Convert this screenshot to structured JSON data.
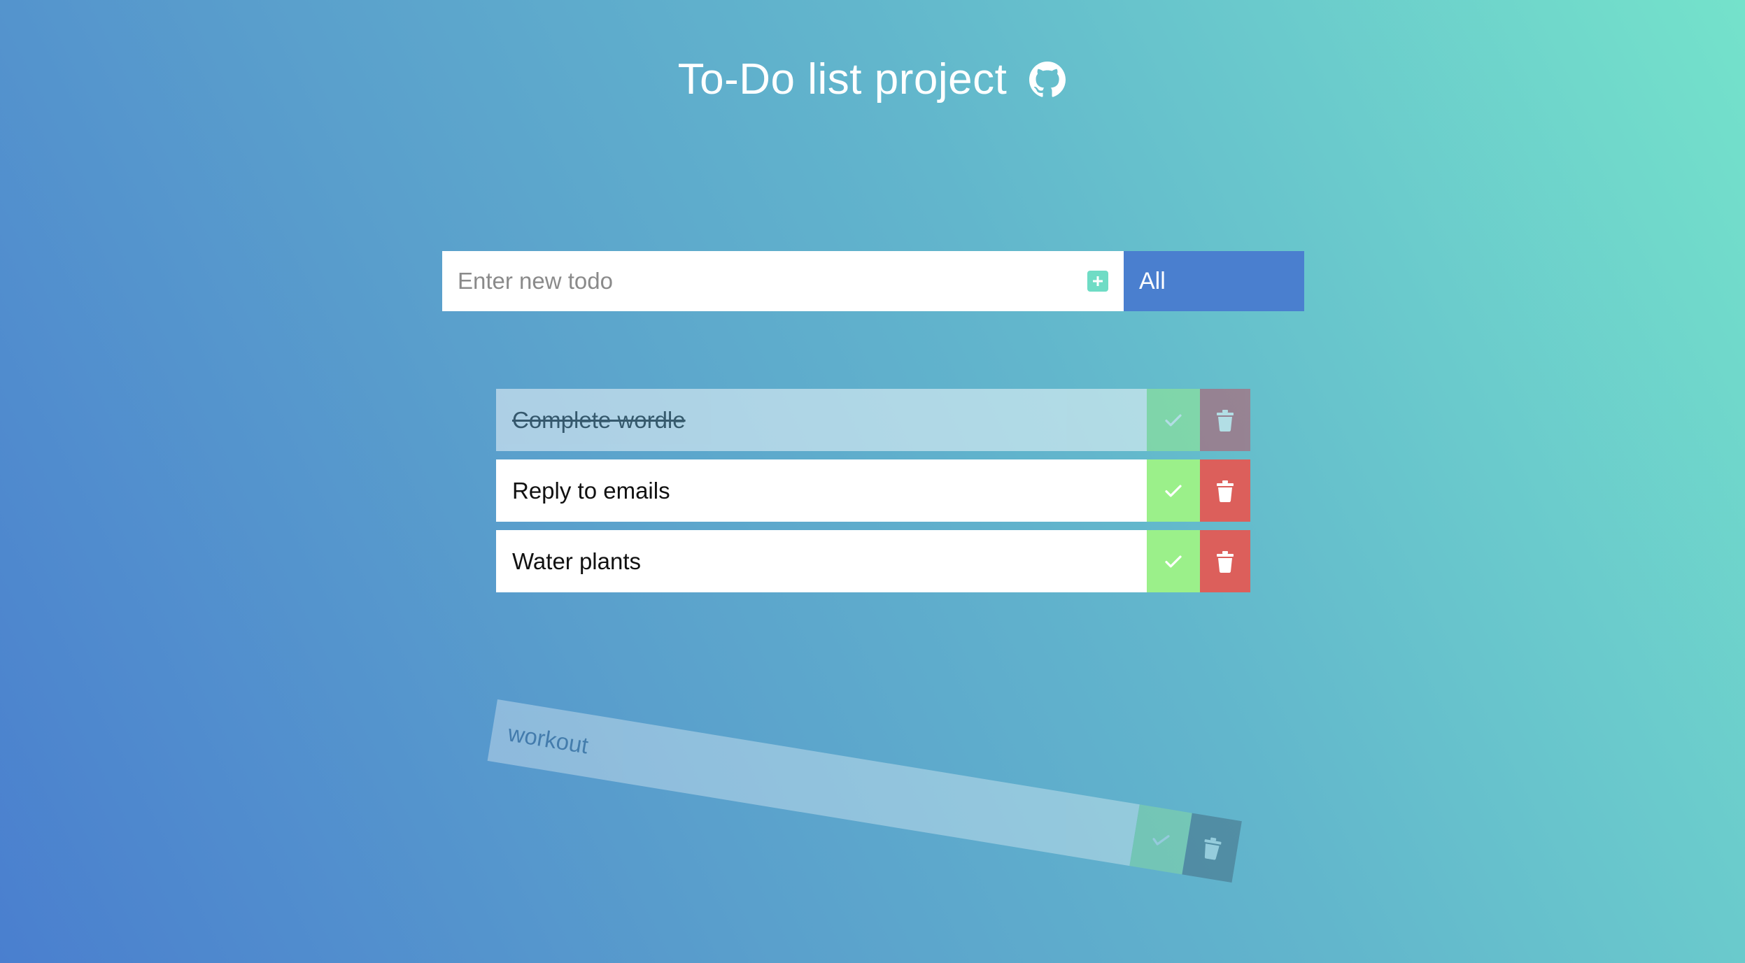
{
  "header": {
    "title": "To-Do list project",
    "icon": "github-icon"
  },
  "input": {
    "placeholder": "Enter new todo",
    "value": "",
    "add_icon": "plus-square-icon"
  },
  "filter": {
    "selected": "All"
  },
  "todos": [
    {
      "text": "Complete wordle",
      "completed": true
    },
    {
      "text": "Reply to emails",
      "completed": false
    },
    {
      "text": "Water plants",
      "completed": false
    }
  ],
  "removing_todo": {
    "text": "workout"
  },
  "colors": {
    "gradient_start": "#4a7fcf",
    "gradient_end": "#74e2cb",
    "filter_background": "#4a7fcf",
    "complete_button": "#9bf08a",
    "delete_button": "#dc5f5b",
    "add_button": "#6fdcc5"
  },
  "icons": {
    "complete": "check-icon",
    "delete": "trash-icon"
  }
}
